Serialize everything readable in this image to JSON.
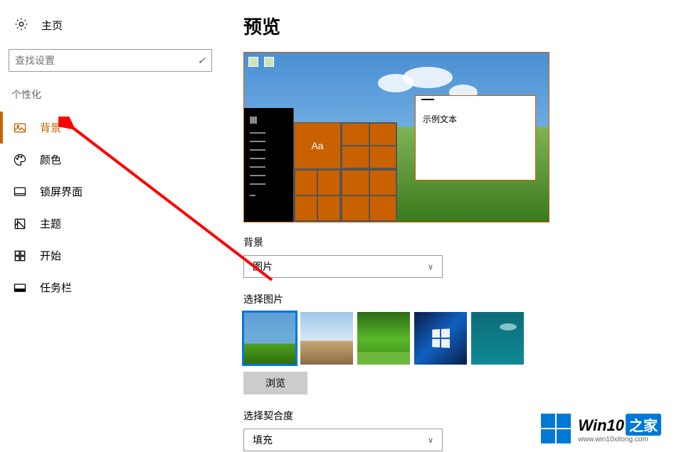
{
  "sidebar": {
    "home": "主页",
    "search_placeholder": "查找设置",
    "section": "个性化",
    "items": [
      {
        "id": "background",
        "label": "背景",
        "icon": "picture-icon",
        "active": true
      },
      {
        "id": "colors",
        "label": "颜色",
        "icon": "palette-icon",
        "active": false
      },
      {
        "id": "lockscreen",
        "label": "锁屏界面",
        "icon": "lockscreen-icon",
        "active": false
      },
      {
        "id": "themes",
        "label": "主题",
        "icon": "themes-icon",
        "active": false
      },
      {
        "id": "start",
        "label": "开始",
        "icon": "start-icon",
        "active": false
      },
      {
        "id": "taskbar",
        "label": "任务栏",
        "icon": "taskbar-icon",
        "active": false
      }
    ]
  },
  "main": {
    "preview_title": "预览",
    "sample_text": "示例文本",
    "tile_aa": "Aa",
    "background_label": "背景",
    "background_select": "图片",
    "choose_picture_label": "选择图片",
    "browse_label": "浏览",
    "fit_label": "选择契合度",
    "fit_select": "填充"
  },
  "watermark": {
    "title": "Win10",
    "suffix": "之家",
    "url": "www.win10xitong.com"
  }
}
